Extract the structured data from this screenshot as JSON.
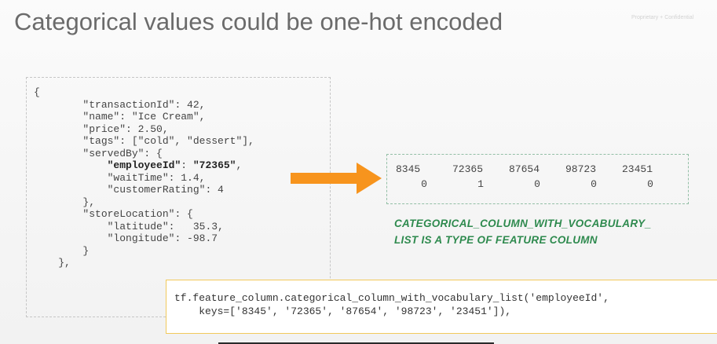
{
  "slide": {
    "title": "Categorical values could be one-hot encoded",
    "confidential": "Proprietary + Confidential"
  },
  "json_example": {
    "lines": [
      {
        "indent": "",
        "text": "{"
      },
      {
        "indent": "        ",
        "text": "\"transactionId\": 42,"
      },
      {
        "indent": "        ",
        "text": "\"name\": \"Ice Cream\","
      },
      {
        "indent": "        ",
        "text": "\"price\": 2.50,"
      },
      {
        "indent": "        ",
        "text": "\"tags\": [\"cold\", \"dessert\"],"
      },
      {
        "indent": "        ",
        "text": "\"servedBy\": {"
      },
      {
        "indent": "            ",
        "key": "\"employeeId\"",
        "sep": ": ",
        "value": "\"72365\"",
        "tail": ","
      },
      {
        "indent": "            ",
        "text": "\"waitTime\": 1.4,"
      },
      {
        "indent": "            ",
        "text": "\"customerRating\": 4"
      },
      {
        "indent": "        ",
        "text": "},"
      },
      {
        "indent": "        ",
        "text": "\"storeLocation\": {"
      },
      {
        "indent": "            ",
        "text": "\"latitude\":   35.3,"
      },
      {
        "indent": "            ",
        "text": "\"longitude\": -98.7"
      },
      {
        "indent": "        ",
        "text": "}"
      },
      {
        "indent": "    ",
        "text": "},"
      }
    ]
  },
  "arrow": {
    "color": "#f7941d"
  },
  "one_hot": {
    "vocabulary": [
      "8345",
      "72365",
      "87654",
      "98723",
      "23451"
    ],
    "encoding": [
      "0",
      "1",
      "0",
      "0",
      "0"
    ]
  },
  "annotation": {
    "line1": "CATEGORICAL_COLUMN_WITH_VOCABULARY_",
    "line2": "LIST IS A TYPE OF FEATURE COLUMN",
    "color": "#2e8a4e"
  },
  "tf_code": {
    "line1": "tf.feature_column.categorical_column_with_vocabulary_list('employeeId',",
    "line2": "    keys=['8345', '72365', '87654', '98723', '23451']),"
  },
  "colors": {
    "title": "#6b6b6b",
    "code_box_border": "#f1c95b",
    "one_hot_box_border": "#93bfa6"
  }
}
